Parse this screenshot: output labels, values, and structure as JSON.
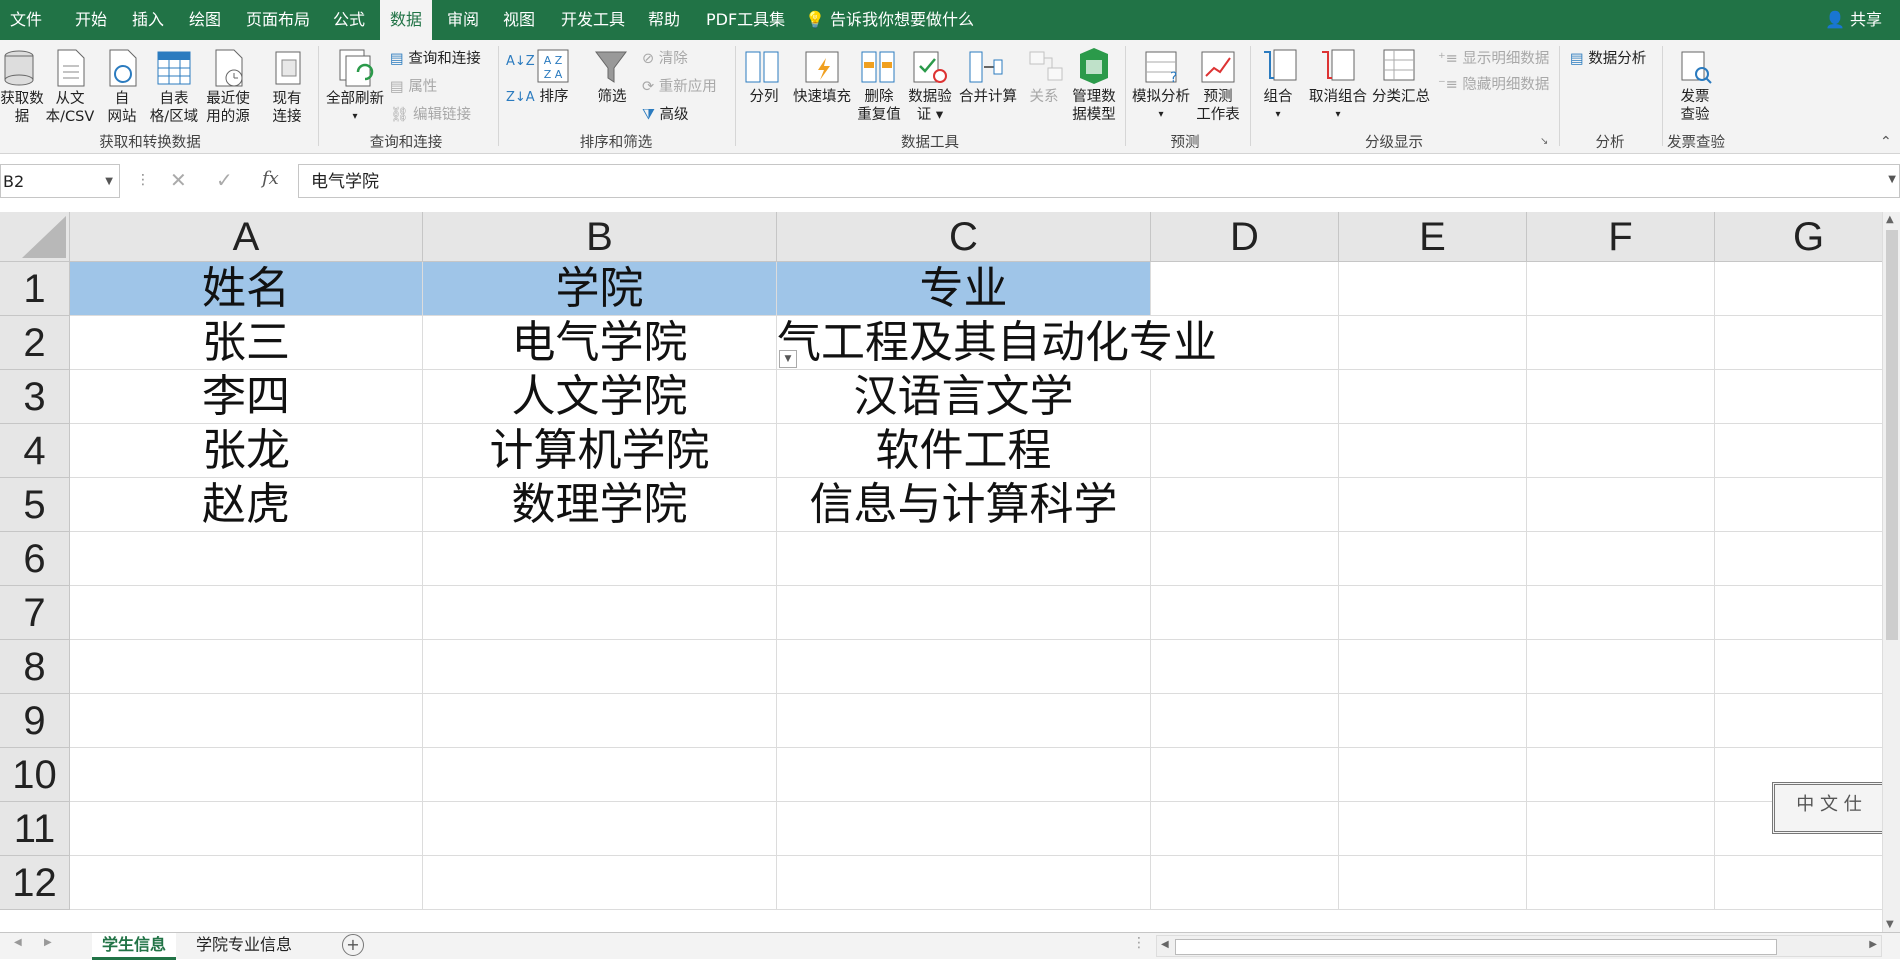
{
  "menu": {
    "tabs": [
      "文件",
      "开始",
      "插入",
      "绘图",
      "页面布局",
      "公式",
      "数据",
      "审阅",
      "视图",
      "开发工具",
      "帮助",
      "PDF工具集"
    ],
    "active_tab": "数据",
    "tell_me": "告诉我你想要做什么",
    "share": "共享"
  },
  "ribbon": {
    "get_data": [
      "获取数",
      "据"
    ],
    "from_text": [
      "从文",
      "本/CSV"
    ],
    "from_web": [
      "自",
      "网站"
    ],
    "from_table": [
      "自表",
      "格/区域"
    ],
    "recent_sources": [
      "最近使",
      "用的源"
    ],
    "existing_conn": [
      "现有",
      "连接"
    ],
    "group_get": "获取和转换数据",
    "refresh_all": [
      "全部刷新",
      "▾"
    ],
    "queries_connections": "查询和连接",
    "properties": "属性",
    "edit_links": "编辑链接",
    "group_queries": "查询和连接",
    "sort": "排序",
    "filter": "筛选",
    "clear": "清除",
    "reapply": "重新应用",
    "advanced": "高级",
    "group_sort": "排序和筛选",
    "text_to_columns": "分列",
    "flash_fill": "快速填充",
    "remove_dup": [
      "删除",
      "重复值"
    ],
    "data_validation": [
      "数据验",
      "证 ▾"
    ],
    "consolidate": "合并计算",
    "relationships": "关系",
    "data_model": [
      "管理数",
      "据模型"
    ],
    "group_tools": "数据工具",
    "what_if": [
      "模拟分析",
      "▾"
    ],
    "forecast_sheet": [
      "预测",
      "工作表"
    ],
    "group_forecast": "预测",
    "group": [
      "组合",
      "▾"
    ],
    "ungroup": [
      "取消组合",
      "▾"
    ],
    "subtotal": "分类汇总",
    "show_detail": "显示明细数据",
    "hide_detail": "隐藏明细数据",
    "group_outline": "分级显示",
    "data_analysis": "数据分析",
    "group_analysis": "分析",
    "invoice_check": [
      "发票",
      "查验"
    ],
    "group_invoice": "发票查验"
  },
  "formula_bar": {
    "name_box": "B2",
    "formula": "电气学院"
  },
  "columns": [
    "A",
    "B",
    "C",
    "D",
    "E",
    "F",
    "G"
  ],
  "rows": [
    "1",
    "2",
    "3",
    "4",
    "5",
    "6",
    "7",
    "8",
    "9",
    "10",
    "11",
    "12"
  ],
  "table": {
    "header": [
      "姓名",
      "学院",
      "专业"
    ],
    "data": [
      [
        "张三",
        "电气学院",
        "气工程及其自动化专业"
      ],
      [
        "李四",
        "人文学院",
        "汉语言文学"
      ],
      [
        "张龙",
        "计算机学院",
        "软件工程"
      ],
      [
        "赵虎",
        "数理学院",
        "信息与计算科学"
      ]
    ]
  },
  "stamp_text": "中 文 仕",
  "sheets": [
    "学生信息",
    "学院专业信息"
  ],
  "active_sheet": "学生信息",
  "colors": {
    "excel_green": "#217346",
    "header_fill": "#9fc5e8"
  }
}
